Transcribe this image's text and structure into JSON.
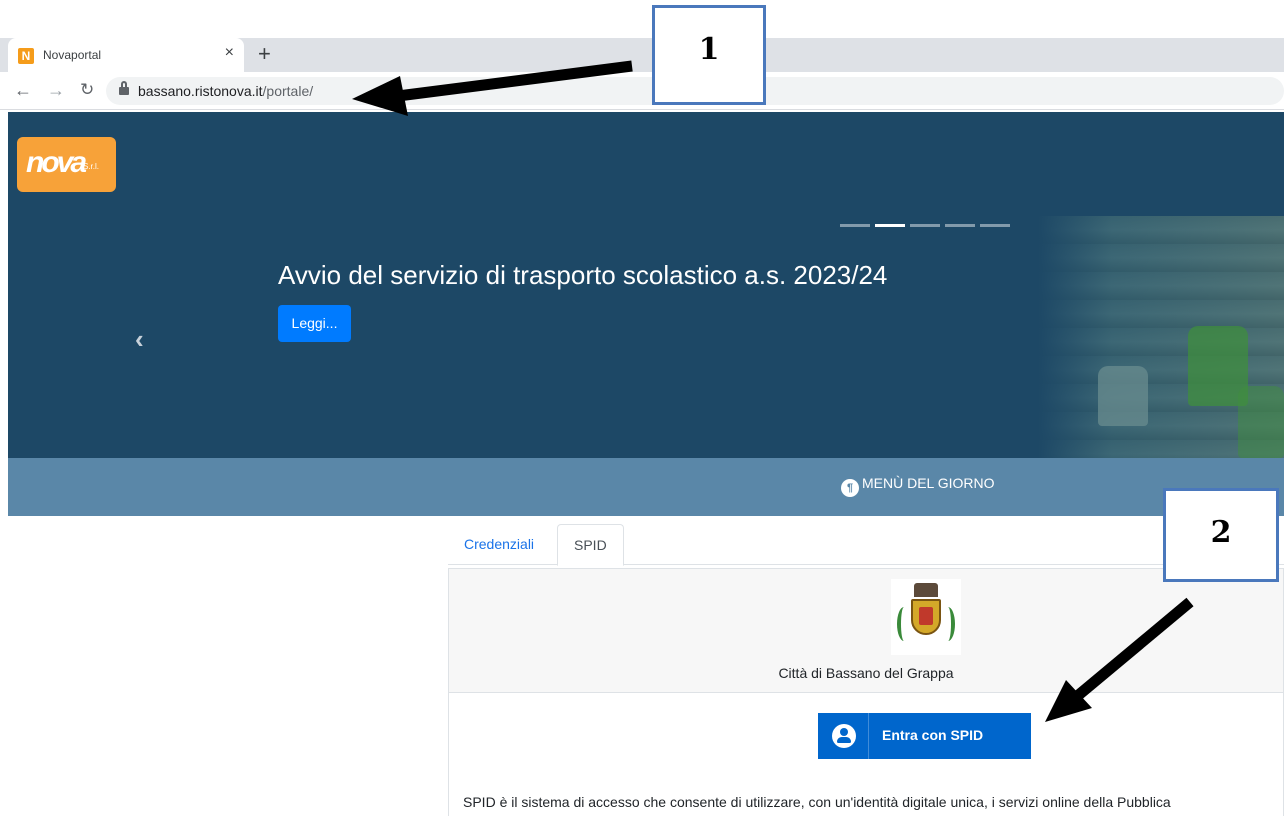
{
  "browser": {
    "tab_title": "Novaportal",
    "favicon_letter": "N",
    "close_glyph": "×",
    "new_tab_glyph": "+",
    "url_domain": "bassano.ristonova.it",
    "url_path": "/portale/"
  },
  "hero": {
    "logo_text": "nova",
    "logo_sub": "S.r.l.",
    "slide_count": 5,
    "active_slide": 2,
    "title": "Avvio del servizio di trasporto scolastico a.s. 2023/24",
    "button_label": "Leggi...",
    "prev_arrow": "‹"
  },
  "menubar": {
    "link_label": "MENÙ DEL GIORNO"
  },
  "login": {
    "tabs": [
      {
        "label": "Credenziali"
      },
      {
        "label": "SPID"
      }
    ],
    "city_name": "Città di Bassano del Grappa",
    "spid_button_label": "Entra con SPID",
    "spid_description": "SPID è il sistema di accesso che consente di utilizzare, con un'identità digitale unica, i servizi online della Pubblica"
  },
  "annotations": {
    "callout_1": "1",
    "callout_2": "2"
  },
  "colors": {
    "hero_bg": "#1d4866",
    "menubar_bg": "#5a87a8",
    "primary_blue": "#007bff",
    "spid_blue": "#0066cc",
    "logo_orange": "#f7a239"
  }
}
